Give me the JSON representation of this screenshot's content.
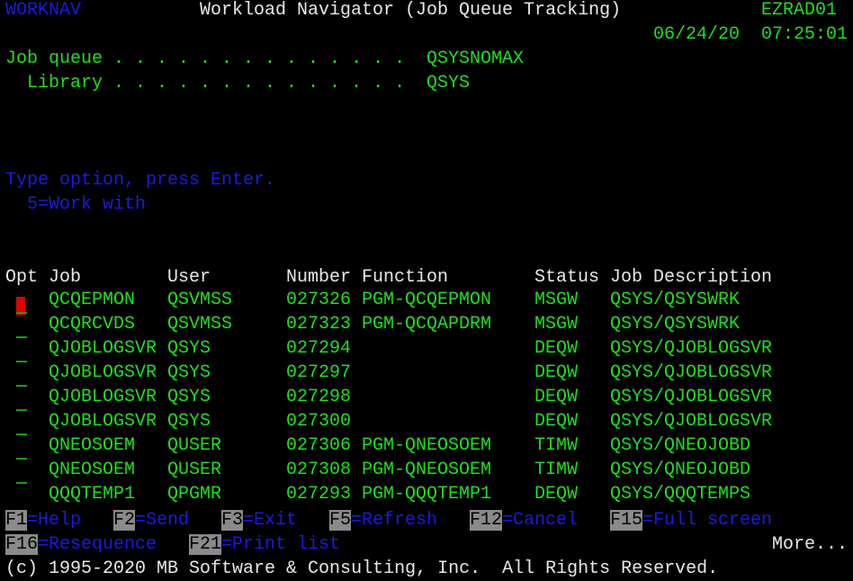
{
  "header": {
    "program": "WORKNAV",
    "title": "Workload Navigator (Job Queue Tracking)",
    "system": "EZRAD01",
    "date": "06/24/20",
    "time": "07:25:01"
  },
  "fields": {
    "job_queue_label": "Job queue . . . . . . . . . . . . . .",
    "job_queue_value": "QSYSNOMAX",
    "library_label": "Library . . . . . . . . . . . . . .",
    "library_value": "QSYS"
  },
  "instructions": {
    "line1": "Type option, press Enter.",
    "line2": "5=Work with"
  },
  "table": {
    "headers": {
      "opt": "Opt",
      "job": "Job",
      "user": "User",
      "number": "Number",
      "function": "Function",
      "status": "Status",
      "jobd": "Job Description"
    },
    "rows": [
      {
        "job": "QCQEPMON",
        "user": "QSVMSS",
        "number": "027326",
        "function": "PGM-QCQEPMON",
        "status": "MSGW",
        "jobd": "QSYS/QSYSWRK"
      },
      {
        "job": "QCQRCVDS",
        "user": "QSVMSS",
        "number": "027323",
        "function": "PGM-QCQAPDRM",
        "status": "MSGW",
        "jobd": "QSYS/QSYSWRK"
      },
      {
        "job": "QJOBLOGSVR",
        "user": "QSYS",
        "number": "027294",
        "function": "",
        "status": "DEQW",
        "jobd": "QSYS/QJOBLOGSVR"
      },
      {
        "job": "QJOBLOGSVR",
        "user": "QSYS",
        "number": "027297",
        "function": "",
        "status": "DEQW",
        "jobd": "QSYS/QJOBLOGSVR"
      },
      {
        "job": "QJOBLOGSVR",
        "user": "QSYS",
        "number": "027298",
        "function": "",
        "status": "DEQW",
        "jobd": "QSYS/QJOBLOGSVR"
      },
      {
        "job": "QJOBLOGSVR",
        "user": "QSYS",
        "number": "027300",
        "function": "",
        "status": "DEQW",
        "jobd": "QSYS/QJOBLOGSVR"
      },
      {
        "job": "QNEOSOEM",
        "user": "QUSER",
        "number": "027306",
        "function": "PGM-QNEOSOEM",
        "status": "TIMW",
        "jobd": "QSYS/QNEOJOBD"
      },
      {
        "job": "QNEOSOEM",
        "user": "QUSER",
        "number": "027308",
        "function": "PGM-QNEOSOEM",
        "status": "TIMW",
        "jobd": "QSYS/QNEOJOBD"
      },
      {
        "job": "QQQTEMP1",
        "user": "QPGMR",
        "number": "027293",
        "function": "PGM-QQQTEMP1",
        "status": "DEQW",
        "jobd": "QSYS/QQQTEMPS"
      }
    ]
  },
  "fkeys": [
    {
      "key": "F1",
      "label": "=Help"
    },
    {
      "key": "F2",
      "label": "=Send"
    },
    {
      "key": "F3",
      "label": "=Exit"
    },
    {
      "key": "F5",
      "label": "=Refresh"
    },
    {
      "key": "F12",
      "label": "=Cancel"
    },
    {
      "key": "F15",
      "label": "=Full screen"
    },
    {
      "key": "F16",
      "label": "=Resequence"
    },
    {
      "key": "F21",
      "label": "=Print list"
    }
  ],
  "more": "More...",
  "copyright": "(c) 1995-2020 MB Software & Consulting, Inc.  All Rights Reserved.",
  "colors": {
    "green": "#1ee01e",
    "white": "#e8e8e8",
    "blue": "#1a1ae6",
    "cursor": "#e00000",
    "fkey_bg": "#8a8a8a"
  }
}
